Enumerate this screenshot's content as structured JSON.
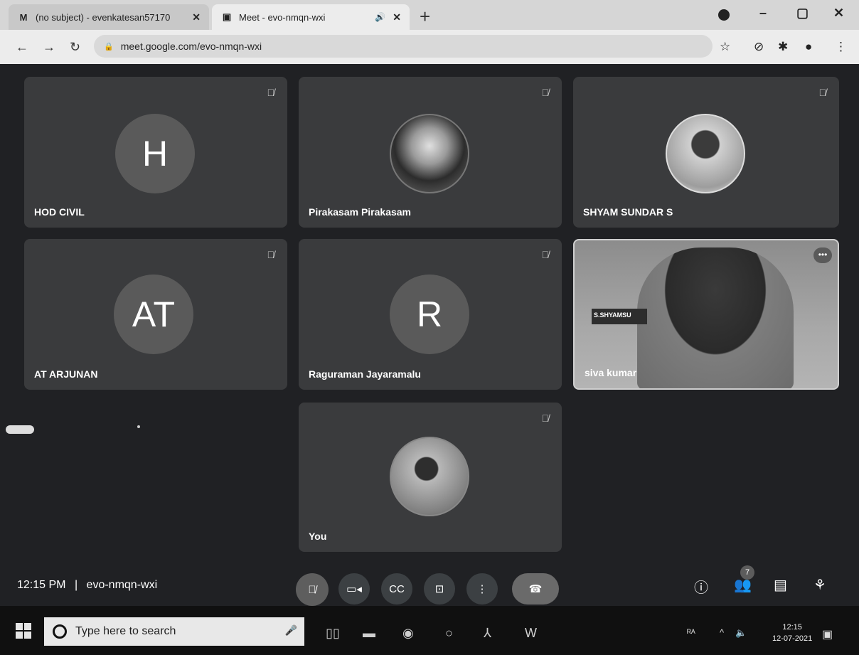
{
  "browser": {
    "tabs": [
      {
        "favicon": "M",
        "title": "(no subject) - evenkatesan57170",
        "close": "✕"
      },
      {
        "favicon": "▣",
        "title": "Meet - evo-nmqn-wxi",
        "audio": "🔊",
        "close": "✕"
      }
    ],
    "new_tab": "+",
    "url": "meet.google.com/evo-nmqn-wxi",
    "window_controls": {
      "minimize": "–",
      "maximize": "▢",
      "close": "✕"
    }
  },
  "meet": {
    "tiles": [
      {
        "name": "HOD CIVIL",
        "avatar_letter": "H",
        "muted": true
      },
      {
        "name": "Pirakasam Pirakasam",
        "avatar_photo": "penguin",
        "muted": true
      },
      {
        "name": "SHYAM SUNDAR S",
        "avatar_photo": "man-portrait",
        "muted": true
      },
      {
        "name": "AT ARJUNAN",
        "avatar_letter": "AT",
        "muted": true
      },
      {
        "name": "Raguraman Jayaramalu",
        "avatar_letter": "R",
        "muted": true
      },
      {
        "name": "siva kumar",
        "video": true,
        "banner": "S.SHYAMSU"
      },
      {
        "name": "You",
        "avatar_photo": "selfie",
        "muted": true
      }
    ],
    "bottom_bar": {
      "time": "12:15 PM",
      "separator": "|",
      "meeting_code": "evo-nmqn-wxi",
      "participant_count": "7"
    }
  },
  "taskbar": {
    "search_placeholder": "Type here to search",
    "clock_time": "12:15",
    "clock_date": "12-07-2021"
  },
  "colors": {
    "stage_bg": "#202124",
    "tile_bg": "#3a3b3d",
    "text": "#ffffff"
  }
}
